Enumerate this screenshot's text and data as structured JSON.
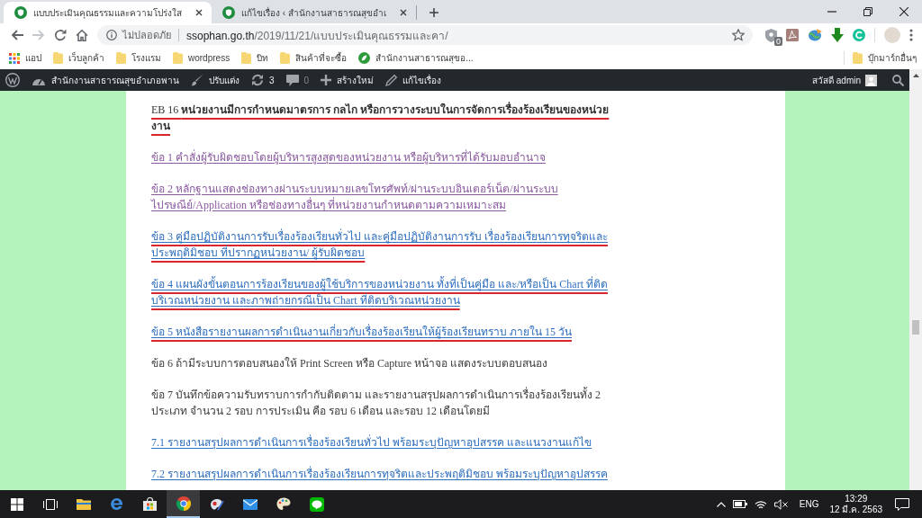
{
  "browser": {
    "tabs": [
      {
        "title": "แบบประเมินคุณธรรมและความโปร่งใส",
        "selected": true
      },
      {
        "title": "แก้ไขเรื่อง ‹ สำนักงานสาธารณสุขอำเ",
        "selected": false
      }
    ],
    "nav_buttons": [
      {
        "kind": "back",
        "disabled": false
      },
      {
        "kind": "forward",
        "disabled": true
      },
      {
        "kind": "reload",
        "disabled": false
      },
      {
        "kind": "home",
        "disabled": false
      }
    ],
    "address_bar": {
      "security_label": "ไม่ปลอดภัย",
      "url": "ssophan.go.th/2019/11/21/แบบประเมินคุณธรรมและคา/",
      "bookmarked": false
    },
    "extension_badge": "0",
    "bookmarks": [
      {
        "kind": "apps",
        "label": "แอป"
      },
      {
        "kind": "folder",
        "label": "เว็บลูกค้า"
      },
      {
        "kind": "folder",
        "label": "โรงแรม"
      },
      {
        "kind": "folder",
        "label": "wordpress"
      },
      {
        "kind": "folder",
        "label": "บิท"
      },
      {
        "kind": "folder",
        "label": "สินค้าที่จะซื้อ"
      },
      {
        "kind": "site",
        "label": "สำนักงานสาธารณสุขอ..."
      }
    ],
    "other_bookmarks": "บุ๊กมาร์กอื่นๆ"
  },
  "admin_bar": {
    "items": [
      {
        "kind": "logo",
        "dimmed": false
      },
      {
        "kind": "site",
        "label": "สำนักงานสาธารณสุขอำเภอพาน",
        "dimmed": false
      },
      {
        "kind": "customize",
        "label": "ปรับแต่ง",
        "dimmed": false
      },
      {
        "kind": "updates",
        "label": "3",
        "dimmed": false
      },
      {
        "kind": "comments",
        "label": "0",
        "dimmed": true
      },
      {
        "kind": "new",
        "label": "สร้างใหม่",
        "dimmed": false
      },
      {
        "kind": "edit",
        "label": "แก้ไขเรื่อง",
        "dimmed": false
      }
    ],
    "greeting": "สวัสดี admin"
  },
  "article": {
    "heading": {
      "text": "EB 16 **หน่วยงานมีการกำหนดมาตรการ กลไก หรือการวางระบบในการจัดการเรื่องร้องเรียนของหน่วยงาน**",
      "marked": true
    },
    "items": [
      {
        "kind": "link",
        "text": "ข้อ 1 คำสั่งผู้รับผิดชอบโดยผู้บริหารสูงสุดของหน่วยงาน หรือผู้บริหารที่ได้รับมอบอำนาจ",
        "visited": true,
        "marked": false
      },
      {
        "kind": "link",
        "text": "ข้อ 2 หลักฐานแสดงช่องทางผ่านระบบหมายเลขโทรศัพท์/ผ่านระบบอินเตอร์เน็ต/ผ่านระบบไปรษณีย์/Application หรือช่องทางอื่นๆ ที่หน่วยงานกำหนดตามความเหมาะสม",
        "visited": true,
        "marked": false
      },
      {
        "kind": "link",
        "text": "ข้อ 3 คู่มือปฏิบัติงานการรับเรื่องร้องเรียนทั่วไป และคู่มือปฏิบัติงานการรับ เรื่องร้องเรียนการทุจริตและประพฤติมิชอบ ที่ปรากฏหน่วยงาน/ ผู้รับผิดชอบ",
        "visited": false,
        "marked": true
      },
      {
        "kind": "link",
        "text": "ข้อ 4 แผนผังขั้นตอนการร้องเรียนของผู้ใช้บริการของหน่วยงาน ทั้งที่เป็นคู่มือ และ/หรือเป็น Chart ที่ติดบริเวณหน่วยงาน และภาพถ่ายกรณีเป็น Chart ที่ติดบริเวณหน่วยงาน",
        "visited": false,
        "marked": true
      },
      {
        "kind": "link",
        "text": "ข้อ 5 หนังสือรายงานผลการดำเนินงานเกี่ยวกับเรื่องร้องเรียนให้ผู้ร้องเรียนทราบ ภายใน 15 วัน",
        "visited": false,
        "marked": true
      },
      {
        "kind": "text",
        "text": "ข้อ 6 ถ้ามีระบบการตอบสนองให้ Print Screen หรือ Capture หน้าจอ แสดงระบบตอบสนอง",
        "marked": false
      },
      {
        "kind": "text",
        "text": "ข้อ 7 บันทึกข้อความรับทราบการกำกับติดตาม และรายงานสรุปผลการดำเนินการเรื่องร้องเรียนทั้ง 2 ประเภท จำนวน 2 รอบ การประเมิน คือ รอบ 6 เดือน และรอบ 12 เดือนโดยมี",
        "marked": false
      },
      {
        "kind": "link",
        "text": "7.1 รายงานสรุปผลการดำเนินการเรื่องร้องเรียนทั่วไป พร้อมระบุปัญหาอุปสรรค และแนวงานแก้ไข",
        "visited": false,
        "marked": false
      },
      {
        "kind": "link",
        "text": "7.2 รายงานสรุปผลการดำเนินการเรื่องร้องเรียนการทุจริตและประพฤติมิชอบ พร้อมระบุปัญหาอุปสรรค",
        "visited": false,
        "marked": false
      }
    ]
  },
  "taskbar": {
    "apps": [
      {
        "kind": "explorer",
        "active": false
      },
      {
        "kind": "edge",
        "active": false
      },
      {
        "kind": "store",
        "active": false
      },
      {
        "kind": "chrome",
        "active": true
      },
      {
        "kind": "sticker",
        "active": false
      },
      {
        "kind": "mail",
        "active": false
      },
      {
        "kind": "paint",
        "active": false
      },
      {
        "kind": "line",
        "active": false
      }
    ],
    "tray": {
      "volume_muted": true,
      "language": "ENG",
      "time": "13:29",
      "date": "12 มี.ค. 2563"
    }
  }
}
